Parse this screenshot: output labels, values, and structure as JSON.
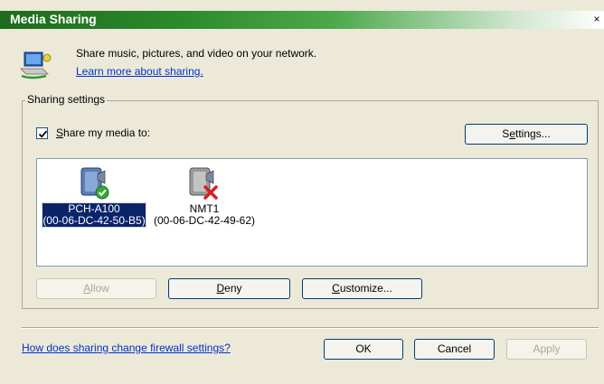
{
  "window": {
    "title": "Media Sharing",
    "close_glyph": "×"
  },
  "header": {
    "icon": "media-network-icon",
    "description": "Share music, pictures, and video on your network.",
    "learn_more": "Learn more about sharing."
  },
  "sharing_settings": {
    "legend": "Sharing settings",
    "share_checkbox": {
      "checked": true,
      "label_mnemonic": "S",
      "label_rest": "hare my media to:"
    },
    "settings_button": {
      "pre": "S",
      "mnemonic": "e",
      "post": "ttings..."
    },
    "devices": [
      {
        "name": "PCH-A100",
        "mac": "(00-06-DC-42-50-B5)",
        "status_icon": "allowed-check-icon",
        "selected": true
      },
      {
        "name": "NMT1",
        "mac": "(00-06-DC-42-49-62)",
        "status_icon": "denied-x-icon",
        "selected": false
      }
    ],
    "allow_button": {
      "mnemonic": "A",
      "post": "llow",
      "enabled": false
    },
    "deny_button": {
      "mnemonic": "D",
      "post": "eny",
      "enabled": true
    },
    "customize_button": {
      "mnemonic": "C",
      "post": "ustomize...",
      "enabled": true
    }
  },
  "footer": {
    "firewall_link": "How does sharing change firewall settings?",
    "ok": "OK",
    "cancel": "Cancel",
    "apply": "Apply",
    "apply_enabled": false
  },
  "colors": {
    "title_green": "#2c8a2c",
    "selection": "#0a246a",
    "link": "#0033cc",
    "dialog_bg": "#ece9d8"
  }
}
